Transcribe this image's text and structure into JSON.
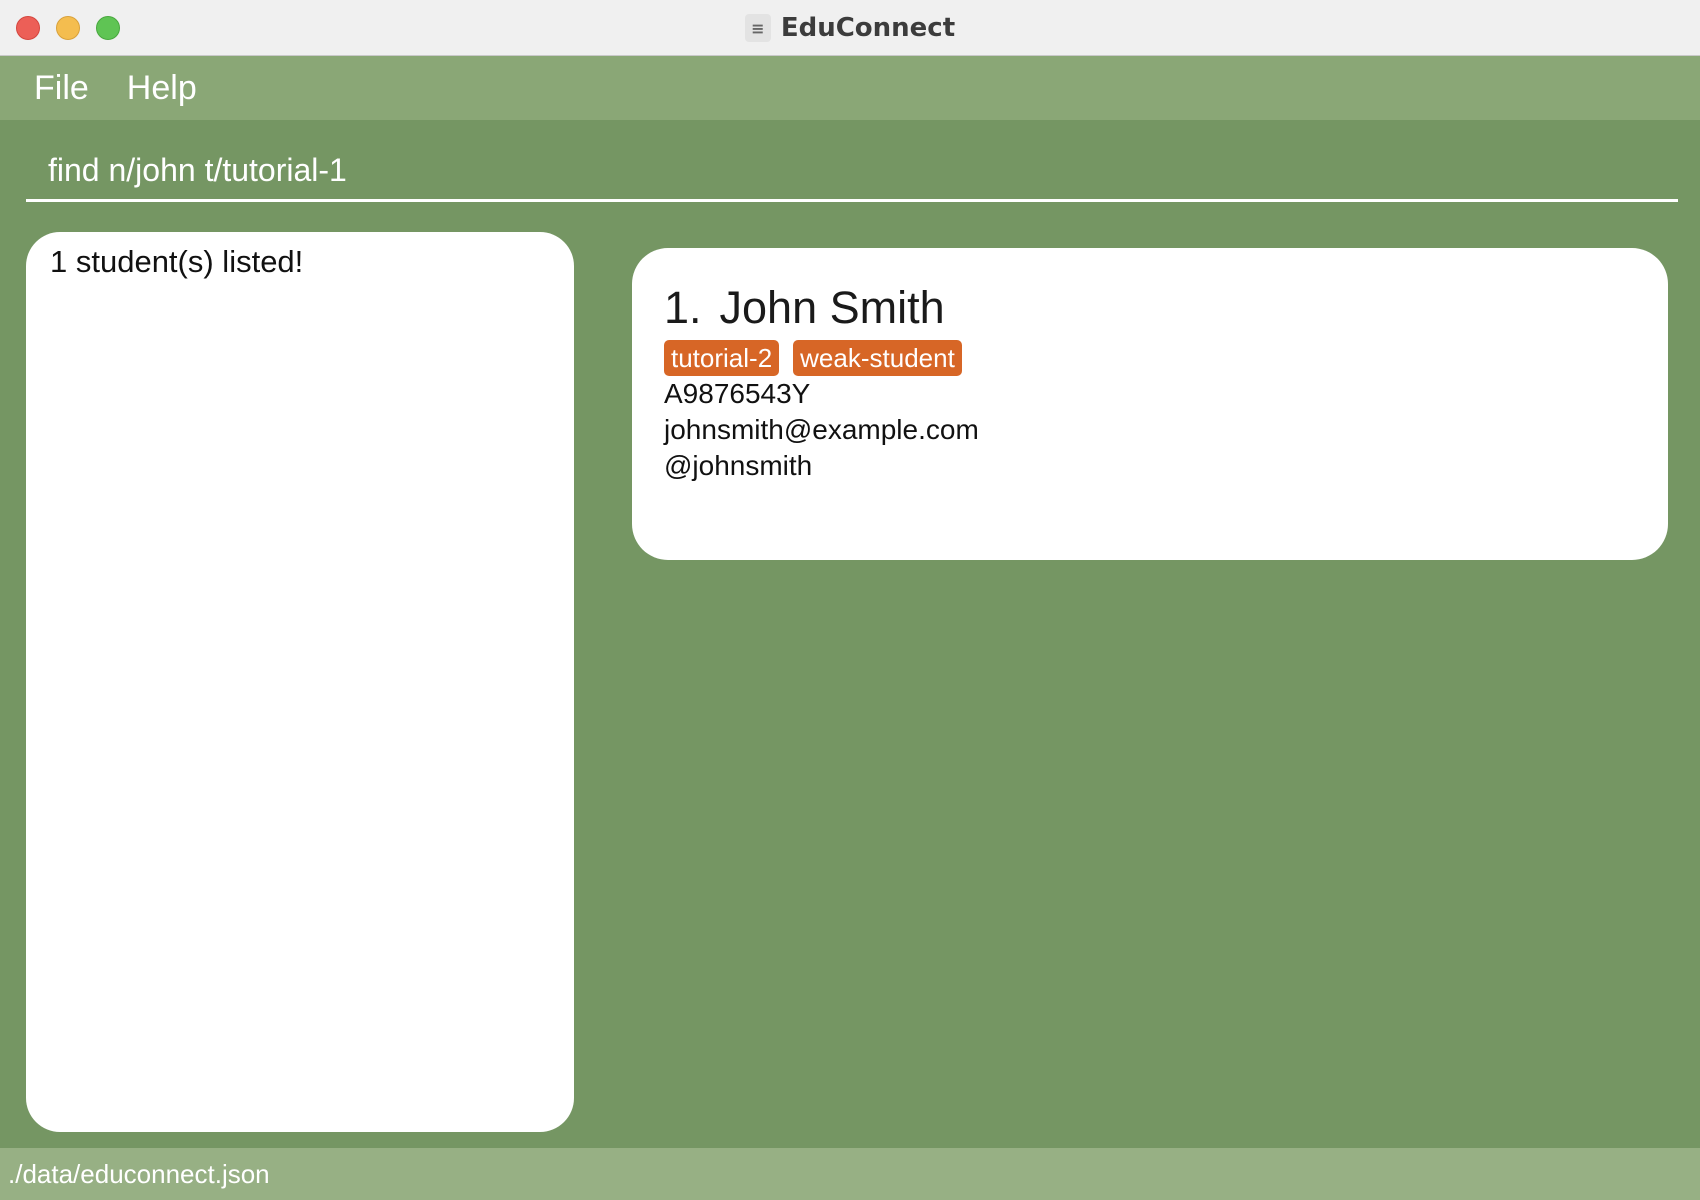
{
  "window": {
    "title": "EduConnect"
  },
  "menu": {
    "items": [
      "File",
      "Help"
    ]
  },
  "command": {
    "value": "find n/john t/tutorial-1"
  },
  "result": {
    "message": "1 student(s) listed!"
  },
  "students": [
    {
      "index": "1.",
      "name": "John Smith",
      "tags": [
        "tutorial-2",
        "weak-student"
      ],
      "student_id": "A9876543Y",
      "email": "johnsmith@example.com",
      "telegram": "@johnsmith"
    }
  ],
  "status": {
    "file_path": "./data/educonnect.json"
  },
  "colors": {
    "menubar": "#8aa776",
    "main_bg": "#759663",
    "statusbar": "#97b084",
    "tag": "#d76626"
  }
}
